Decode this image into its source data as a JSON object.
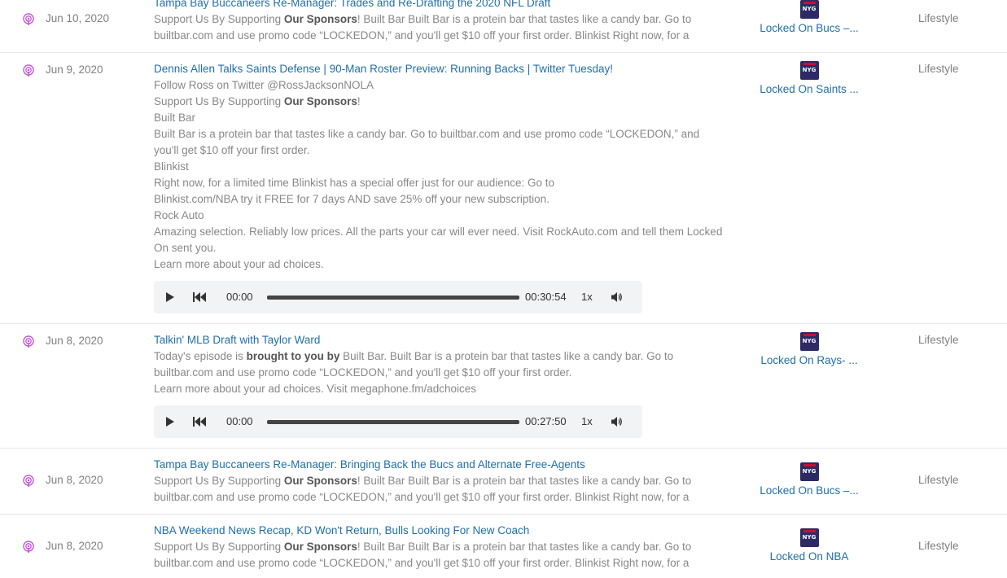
{
  "episodes": [
    {
      "date": "Jun 10, 2020",
      "title": "Tampa Bay Buccaneers Re-Manager: Trades and Re-Drafting the 2020 NFL Draft",
      "desc_line1_pre": "Support Us By Supporting ",
      "desc_line1_bold": "Our Sponsors",
      "desc_line1_post": "!  Built Bar Built Bar is a protein bar that tastes like a candy bar. Go to",
      "desc_line2": "builtbar.com and use promo code “LOCKEDON,” and you'll get $10 off your first order. Blinkist Right now, for a",
      "show_name": "Locked On Bucs –...",
      "logo_text": "NYG",
      "category": "Lifestyle"
    },
    {
      "date": "Jun 9, 2020",
      "title": "Dennis Allen Talks Saints Defense | 90-Man Roster Preview: Running Backs | Twitter Tuesday!",
      "lines": [
        "Follow Ross on Twitter @RossJacksonNOLA",
        "Built Bar",
        "Built Bar is a protein bar that tastes like a candy bar. Go to builtbar.com and use promo code “LOCKEDON,” and",
        "you'll get $10 off your first order.",
        "Blinkist",
        "Right now, for a limited time Blinkist has a special offer just for our audience: Go to",
        "Blinkist.com/NBA try it FREE for 7 days AND save 25% off your new subscription.",
        "Rock Auto",
        "Amazing selection. Reliably low prices. All the parts your car will ever need. Visit RockAuto.com and tell them Locked",
        "On sent you.",
        "Learn more about your ad choices."
      ],
      "sponsor_pre": "Support Us By Supporting ",
      "sponsor_bold": "Our Sponsors",
      "sponsor_post": "!",
      "player": {
        "current": "00:00",
        "duration": "00:30:54",
        "speed": "1x",
        "progress": 0
      },
      "show_name": "Locked On Saints ...",
      "logo_text": "NYG",
      "category": "Lifestyle"
    },
    {
      "date": "Jun 8, 2020",
      "title": "Talkin' MLB Draft with Taylor Ward",
      "line1_pre": "Today's episode is ",
      "line1_bold": "brought to you by",
      "line1_post": " Built Bar. Built Bar is a protein bar that tastes like a candy bar. Go to",
      "line2": "builtbar.com and use promo code “LOCKEDON,” and you'll get $10 off your first order.",
      "line3": "Learn more about your ad choices. Visit megaphone.fm/adchoices",
      "player": {
        "current": "00:00",
        "duration": "00:27:50",
        "speed": "1x",
        "progress": 0
      },
      "show_name": "Locked On Rays- ...",
      "logo_text": "NYG",
      "category": "Lifestyle"
    },
    {
      "date": "Jun 8, 2020",
      "title": "Tampa Bay Buccaneers Re-Manager: Bringing Back the Bucs and Alternate Free-Agents",
      "desc_line1_pre": "Support Us By Supporting ",
      "desc_line1_bold": "Our Sponsors",
      "desc_line1_post": "!  Built Bar Built Bar is a protein bar that tastes like a candy bar. Go to",
      "desc_line2": "builtbar.com and use promo code “LOCKEDON,” and you'll get $10 off your first order. Blinkist Right now, for a",
      "show_name": "Locked On Bucs –...",
      "logo_text": "NYG",
      "category": "Lifestyle"
    },
    {
      "date": "Jun 8, 2020",
      "title": "NBA Weekend News Recap, KD Won't Return, Bulls Looking For New Coach",
      "desc_line1_pre": "Support Us By Supporting ",
      "desc_line1_bold": "Our Sponsors",
      "desc_line1_post": "!  Built Bar Built Bar is a protein bar that tastes like a candy bar. Go to",
      "desc_line2": "builtbar.com and use promo code “LOCKEDON,” and you'll get $10 off your first order. Blinkist Right now, for a",
      "show_name": "Locked On NBA",
      "logo_text": "NYG",
      "category": "Lifestyle"
    }
  ],
  "colors": {
    "link": "#1f6fa8",
    "podcast_icon": "#c05ad6",
    "logo_bg": "#2d2a66"
  },
  "icons": {
    "podcast": "podcast-icon",
    "play": "play-icon",
    "rewind": "rewind-icon",
    "volume": "volume-icon"
  }
}
